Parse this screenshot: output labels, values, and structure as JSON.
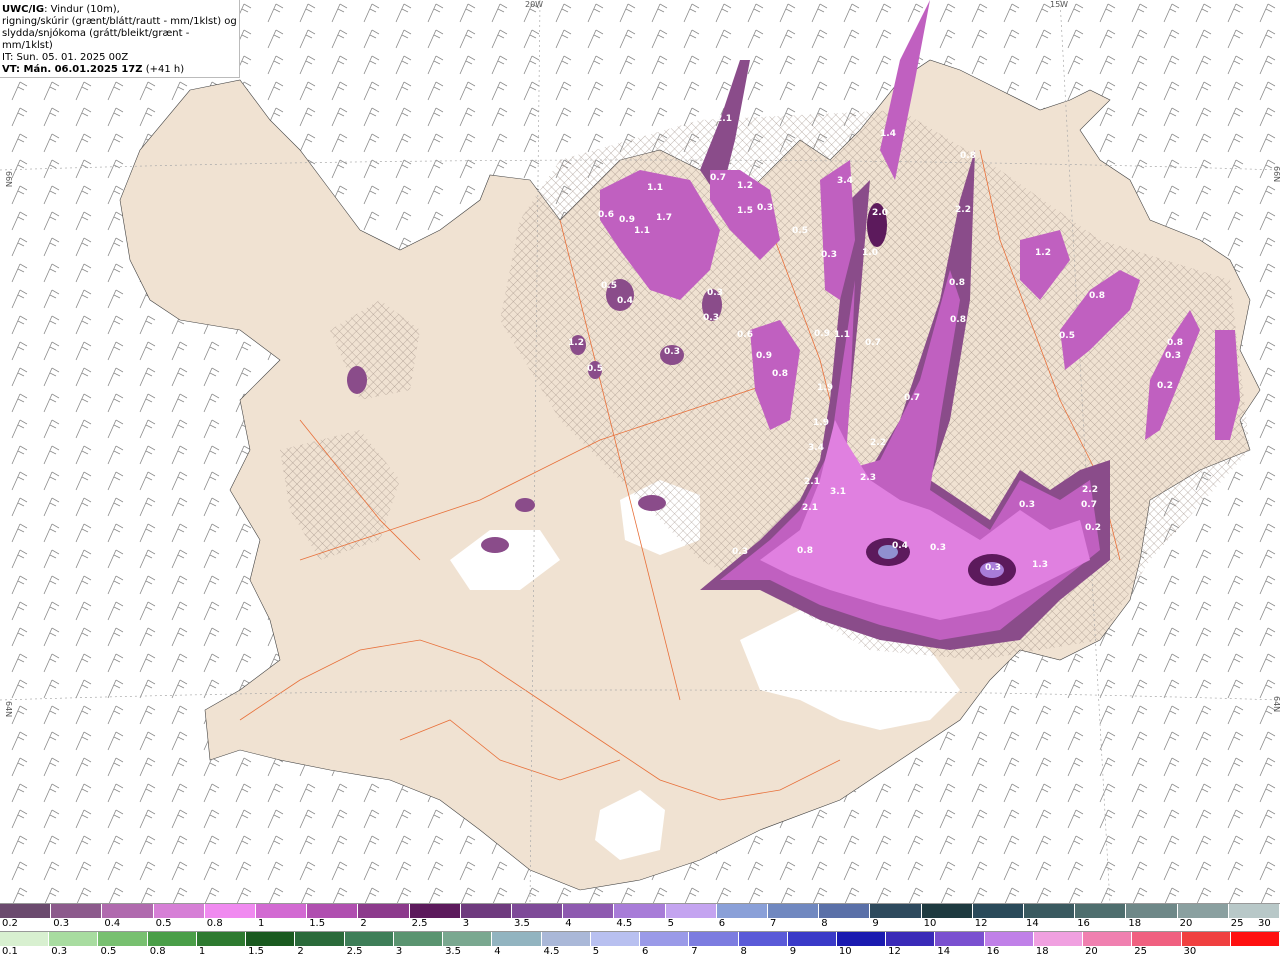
{
  "header": {
    "line1_bold": "UWC/IG",
    "line1_rest": ": Vindur (10m),",
    "line2": "rigning/skúrir (grænt/blátt/rautt - mm/1klst) og",
    "line3": "slydda/snjókoma (grátt/bleikt/grænt - mm/1klst)",
    "line4": "IT: Sun. 05. 01. 2025 00Z",
    "line5_bold": "VT: Mán. 06.01.2025 17Z",
    "line5_rest": " (+41 h)"
  },
  "graticule": {
    "lon_top": [
      "20W",
      "15W"
    ],
    "lat_left": [
      "66N",
      "64N"
    ],
    "lat_right": [
      "66N",
      "64N"
    ]
  },
  "precip_labels": [
    {
      "text": "1.1"
    },
    {
      "text": "0.6"
    },
    {
      "text": "0.9"
    },
    {
      "text": "1.1"
    },
    {
      "text": "1.7"
    },
    {
      "text": "0.7"
    },
    {
      "text": "1.2"
    },
    {
      "text": "1.5"
    },
    {
      "text": "0.3"
    },
    {
      "text": "2.1"
    },
    {
      "text": "3.4"
    },
    {
      "text": "2.0"
    },
    {
      "text": "1.0"
    },
    {
      "text": "1.4"
    },
    {
      "text": "0.8"
    },
    {
      "text": "2.2"
    },
    {
      "text": "1.2"
    },
    {
      "text": "0.8"
    },
    {
      "text": "0.8"
    },
    {
      "text": "0.3"
    },
    {
      "text": "0.5"
    },
    {
      "text": "0.4"
    },
    {
      "text": "0.3"
    },
    {
      "text": "0.3"
    },
    {
      "text": "0.3"
    },
    {
      "text": "1.2"
    },
    {
      "text": "0.5"
    },
    {
      "text": "0.6"
    },
    {
      "text": "0.9"
    },
    {
      "text": "0.8"
    },
    {
      "text": "0.5"
    },
    {
      "text": "0.3"
    },
    {
      "text": "1.1"
    },
    {
      "text": "0.9"
    },
    {
      "text": "0.7"
    },
    {
      "text": "0.8"
    },
    {
      "text": "0.8"
    },
    {
      "text": "0.7"
    },
    {
      "text": "2.2"
    },
    {
      "text": "2.3"
    },
    {
      "text": "1.9"
    },
    {
      "text": "1.9"
    },
    {
      "text": "3.4"
    },
    {
      "text": "2.1"
    },
    {
      "text": "3.1"
    },
    {
      "text": "2.1"
    },
    {
      "text": "2.2"
    },
    {
      "text": "0.7"
    },
    {
      "text": "0.3"
    },
    {
      "text": "0.2"
    },
    {
      "text": "0.4"
    },
    {
      "text": "0.3"
    },
    {
      "text": "0.3"
    },
    {
      "text": "1.3"
    },
    {
      "text": "0.8"
    },
    {
      "text": "0.3"
    },
    {
      "text": "0.5"
    },
    {
      "text": "0.2"
    }
  ],
  "colorbar_snow": {
    "ticks": [
      "0.2",
      "0.3",
      "0.4",
      "0.5",
      "0.8",
      "1",
      "1.5",
      "2",
      "2.5",
      "3",
      "3.5",
      "4",
      "4.5",
      "5",
      "6",
      "7",
      "8",
      "9",
      "10",
      "12",
      "14",
      "16",
      "18",
      "20",
      "25",
      "30"
    ],
    "colors": [
      "#6b4a6e",
      "#8c5a8c",
      "#b06aae",
      "#d67fd6",
      "#f08af0",
      "#d26ad2",
      "#b04fb0",
      "#8c3a8c",
      "#5c1a5c",
      "#6e3a7e",
      "#7e4a98",
      "#8e5ab0",
      "#a87cd8",
      "#c4a4f0",
      "#8aa0d8",
      "#7088c0",
      "#5a70a8",
      "#2e4a5e",
      "#1e3a40",
      "#2a4a5a",
      "#3a5a60",
      "#4e6e6e",
      "#6e8888",
      "#8aa0a0",
      "#b8c8c8"
    ]
  },
  "colorbar_rain": {
    "ticks": [
      "0.1",
      "0.3",
      "0.5",
      "0.8",
      "1",
      "1.5",
      "2",
      "2.5",
      "3",
      "3.5",
      "4",
      "4.5",
      "5",
      "6",
      "7",
      "8",
      "9",
      "10",
      "12",
      "14",
      "16",
      "18",
      "20",
      "25",
      "30"
    ],
    "colors": [
      "#d8f0d0",
      "#a8dca0",
      "#78c070",
      "#4a9e48",
      "#2e7a30",
      "#1a5a20",
      "#2a6a3a",
      "#3e7e58",
      "#5a9470",
      "#7aa890",
      "#92b4c0",
      "#aab8d8",
      "#b8c0f0",
      "#9a9ae8",
      "#7c7ce0",
      "#5a5ad8",
      "#3a3ac8",
      "#1a1ab0",
      "#3a2ab8",
      "#7a50d0",
      "#c080e8",
      "#f0a0e0",
      "#f080b0",
      "#f06080",
      "#f04040",
      "#ff1010"
    ]
  },
  "colors": {
    "land": "#f0e2d2",
    "sea": "#ffffff",
    "roads": "#e8703a",
    "graticule": "#aaaaaa",
    "wind_barbs": "#8a8a8a",
    "hatch": "#9a8a80"
  }
}
